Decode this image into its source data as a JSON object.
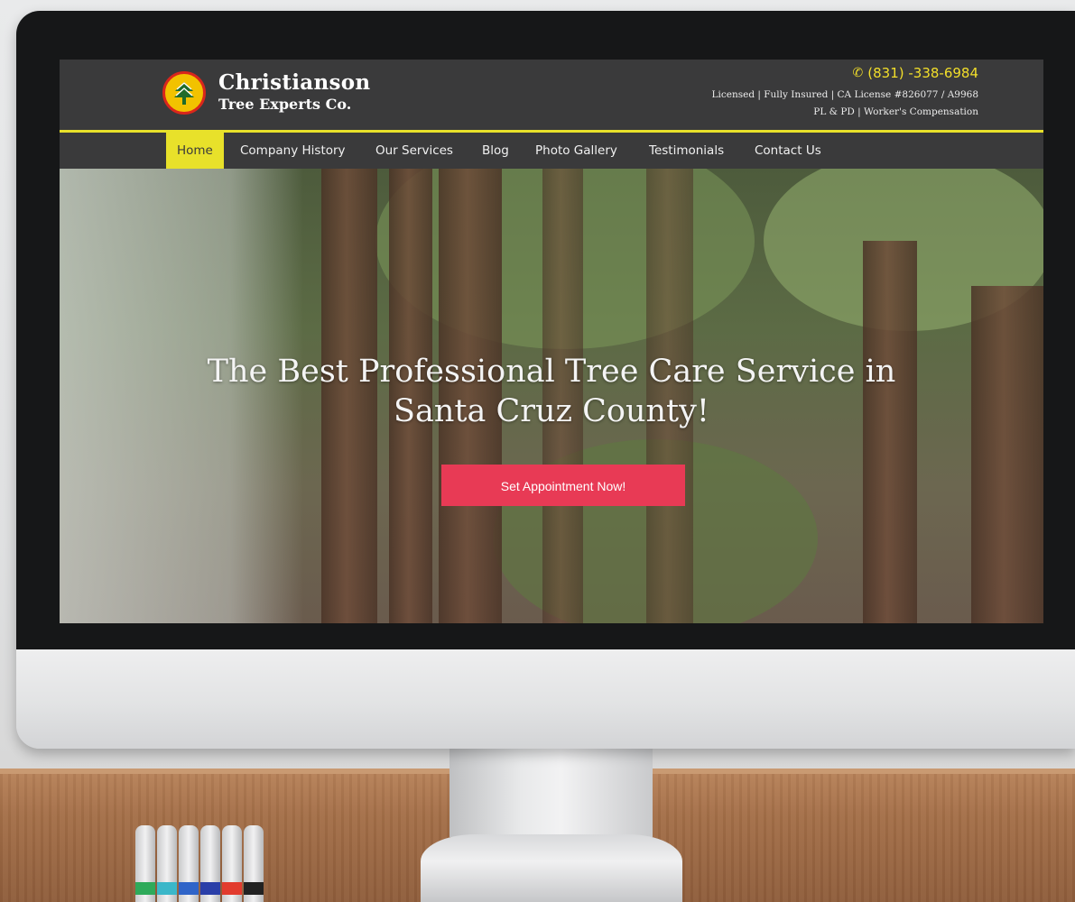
{
  "site": {
    "brand_line1": "Christianson",
    "brand_line2": "Tree Experts Co.",
    "phone": "(831) -338-6984",
    "info_line1": "Licensed | Fully Insured | CA License #826077 / A9968",
    "info_line2": "PL & PD | Worker's Compensation"
  },
  "nav": {
    "items": [
      {
        "label": "Home",
        "active": true
      },
      {
        "label": "Company History"
      },
      {
        "label": "Our Services"
      },
      {
        "label": "Blog"
      },
      {
        "label": "Photo Gallery"
      },
      {
        "label": "Testimonials"
      },
      {
        "label": "Contact Us"
      }
    ]
  },
  "hero": {
    "line1": "The Best Professional Tree Care Service in",
    "line2": "Santa Cruz County!",
    "cta_label": "Set Appointment Now!"
  },
  "icons": {
    "logo": "tree-logo-icon",
    "phone": "phone-icon"
  },
  "colors": {
    "accent": "#e8e12a",
    "cta": "#e83a55",
    "header": "#3a3a3b"
  }
}
